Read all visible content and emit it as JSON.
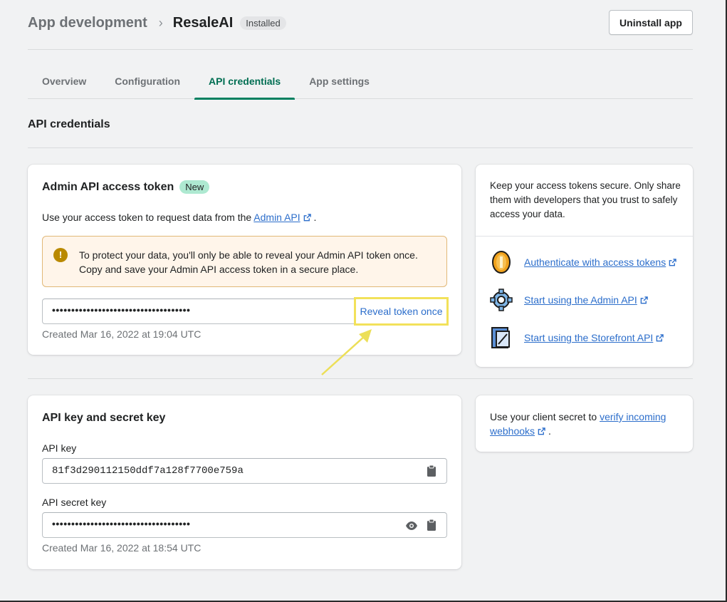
{
  "header": {
    "breadcrumb_parent": "App development",
    "breadcrumb_current": "ResaleAI",
    "status_badge": "Installed",
    "uninstall_label": "Uninstall app"
  },
  "tabs": [
    {
      "label": "Overview",
      "active": false
    },
    {
      "label": "Configuration",
      "active": false
    },
    {
      "label": "API credentials",
      "active": true
    },
    {
      "label": "App settings",
      "active": false
    }
  ],
  "section_title": "API credentials",
  "admin_token_card": {
    "title": "Admin API access token",
    "badge": "New",
    "description_prefix": "Use your access token to request data from the",
    "description_link": "Admin API",
    "description_suffix": ".",
    "warning_text": "To protect your data, you'll only be able to reveal your Admin API token once. Copy and save your Admin API access token in a secure place.",
    "token_masked": "••••••••••••••••••••••••••••••••••••",
    "reveal_label": "Reveal token once",
    "created": "Created Mar 16, 2022 at 19:04 UTC"
  },
  "resources_card": {
    "intro": "Keep your access tokens secure. Only share them with developers that you trust to safely access your data.",
    "links": [
      {
        "label": "Authenticate with access tokens",
        "icon": "coin-icon"
      },
      {
        "label": "Start using the Admin API",
        "icon": "gear-icon"
      },
      {
        "label": "Start using the Storefront API",
        "icon": "storefront-icon"
      }
    ]
  },
  "api_keys_card": {
    "title": "API key and secret key",
    "api_key_label": "API key",
    "api_key_value": "81f3d290112150ddf7a128f7700e759a",
    "secret_label": "API secret key",
    "secret_masked": "••••••••••••••••••••••••••••••••••••",
    "created": "Created Mar 16, 2022 at 18:54 UTC"
  },
  "webhook_card": {
    "text_prefix": "Use your client secret to",
    "link": "verify incoming webhooks",
    "text_suffix": "."
  },
  "colors": {
    "accent": "#008060",
    "link": "#2c6ecb",
    "highlight": "#f2e15a",
    "warning_bg": "#fff5ea"
  }
}
